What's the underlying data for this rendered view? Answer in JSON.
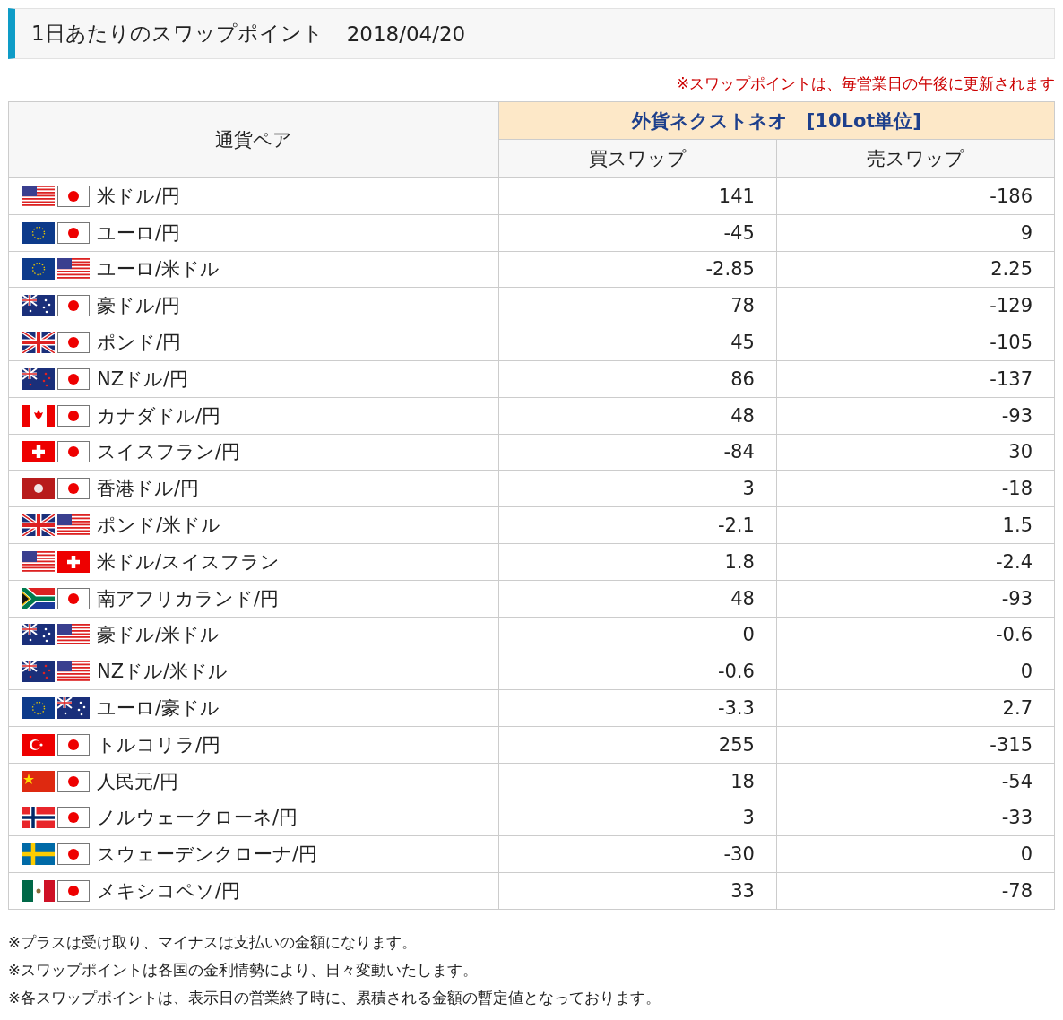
{
  "title": {
    "heading": "1日あたりのスワップポイント",
    "date": "2018/04/20"
  },
  "update_note": "※スワップポイントは、毎営業日の午後に更新されます",
  "table": {
    "pair_header": "通貨ペア",
    "group_header": "外貨ネクストネオ　[10Lot単位]",
    "columns": [
      "買スワップ",
      "売スワップ"
    ],
    "rows": [
      {
        "flags": [
          {
            "kind": "us"
          },
          {
            "kind": "jp"
          }
        ],
        "pair": "米ドル/円",
        "buy": "141",
        "sell": "-186"
      },
      {
        "flags": [
          {
            "kind": "eu"
          },
          {
            "kind": "jp"
          }
        ],
        "pair": "ユーロ/円",
        "buy": "-45",
        "sell": "9"
      },
      {
        "flags": [
          {
            "kind": "eu"
          },
          {
            "kind": "us"
          }
        ],
        "pair": "ユーロ/米ドル",
        "buy": "-2.85",
        "sell": "2.25"
      },
      {
        "flags": [
          {
            "kind": "au"
          },
          {
            "kind": "jp"
          }
        ],
        "pair": "豪ドル/円",
        "buy": "78",
        "sell": "-129"
      },
      {
        "flags": [
          {
            "kind": "gb"
          },
          {
            "kind": "jp"
          }
        ],
        "pair": "ポンド/円",
        "buy": "45",
        "sell": "-105"
      },
      {
        "flags": [
          {
            "kind": "nz"
          },
          {
            "kind": "jp"
          }
        ],
        "pair": "NZドル/円",
        "buy": "86",
        "sell": "-137"
      },
      {
        "flags": [
          {
            "kind": "ca"
          },
          {
            "kind": "jp"
          }
        ],
        "pair": "カナダドル/円",
        "buy": "48",
        "sell": "-93"
      },
      {
        "flags": [
          {
            "kind": "ch"
          },
          {
            "kind": "jp"
          }
        ],
        "pair": "スイスフラン/円",
        "buy": "-84",
        "sell": "30"
      },
      {
        "flags": [
          {
            "kind": "hk"
          },
          {
            "kind": "jp"
          }
        ],
        "pair": "香港ドル/円",
        "buy": "3",
        "sell": "-18"
      },
      {
        "flags": [
          {
            "kind": "gb"
          },
          {
            "kind": "us"
          }
        ],
        "pair": "ポンド/米ドル",
        "buy": "-2.1",
        "sell": "1.5"
      },
      {
        "flags": [
          {
            "kind": "us"
          },
          {
            "kind": "ch"
          }
        ],
        "pair": "米ドル/スイスフラン",
        "buy": "1.8",
        "sell": "-2.4"
      },
      {
        "flags": [
          {
            "kind": "za"
          },
          {
            "kind": "jp"
          }
        ],
        "pair": "南アフリカランド/円",
        "buy": "48",
        "sell": "-93"
      },
      {
        "flags": [
          {
            "kind": "au"
          },
          {
            "kind": "us"
          }
        ],
        "pair": "豪ドル/米ドル",
        "buy": "0",
        "sell": "-0.6"
      },
      {
        "flags": [
          {
            "kind": "nz"
          },
          {
            "kind": "us"
          }
        ],
        "pair": "NZドル/米ドル",
        "buy": "-0.6",
        "sell": "0"
      },
      {
        "flags": [
          {
            "kind": "eu"
          },
          {
            "kind": "au"
          }
        ],
        "pair": "ユーロ/豪ドル",
        "buy": "-3.3",
        "sell": "2.7"
      },
      {
        "flags": [
          {
            "kind": "tr"
          },
          {
            "kind": "jp"
          }
        ],
        "pair": "トルコリラ/円",
        "buy": "255",
        "sell": "-315"
      },
      {
        "flags": [
          {
            "kind": "cn"
          },
          {
            "kind": "jp"
          }
        ],
        "pair": "人民元/円",
        "buy": "18",
        "sell": "-54"
      },
      {
        "flags": [
          {
            "kind": "no"
          },
          {
            "kind": "jp"
          }
        ],
        "pair": "ノルウェークローネ/円",
        "buy": "3",
        "sell": "-33"
      },
      {
        "flags": [
          {
            "kind": "se"
          },
          {
            "kind": "jp"
          }
        ],
        "pair": "スウェーデンクローナ/円",
        "buy": "-30",
        "sell": "0"
      },
      {
        "flags": [
          {
            "kind": "mx"
          },
          {
            "kind": "jp"
          }
        ],
        "pair": "メキシコペソ/円",
        "buy": "33",
        "sell": "-78"
      }
    ]
  },
  "footnotes": [
    "※プラスは受け取り、マイナスは支払いの金額になります。",
    "※スワップポイントは各国の金利情勢により、日々変動いたします。",
    "※各スワップポイントは、表示日の営業終了時に、累積される金額の暫定値となっております。"
  ]
}
